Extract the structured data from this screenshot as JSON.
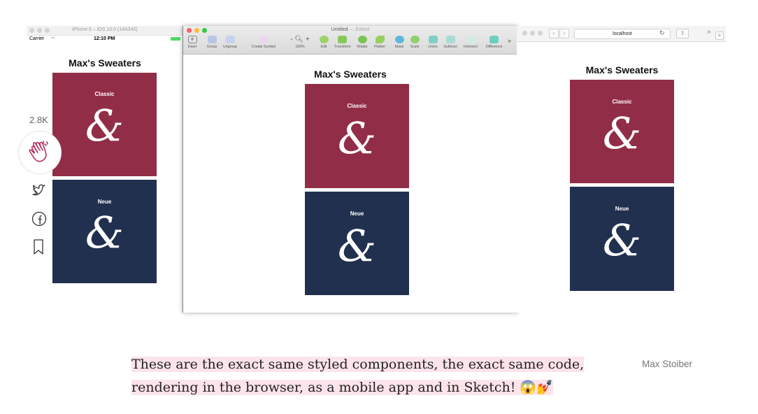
{
  "simulator": {
    "window_title": "iPhone 6 – iOS 10.0 (14A345)",
    "carrier": "Carrier",
    "time": "12:10 PM"
  },
  "sketch": {
    "document_title": "Untitled",
    "edited_label": "— Edited",
    "toolbar": {
      "insert": "Insert",
      "group": "Group",
      "ungroup": "Ungroup",
      "create_symbol": "Create Symbol",
      "zoom": "100%",
      "edit": "Edit",
      "transform": "Transform",
      "rotate": "Rotate",
      "flatten": "Flatten",
      "mask": "Mask",
      "scale": "Scale",
      "union": "Union",
      "subtract": "Subtract",
      "intersect": "Intersect",
      "difference": "Difference"
    }
  },
  "browser": {
    "url": "localhost"
  },
  "app": {
    "title": "Max's Sweaters",
    "cards": [
      {
        "label": "Classic",
        "glyph": "&",
        "color": "#922d48"
      },
      {
        "label": "Neue",
        "glyph": "&",
        "color": "#22304f"
      }
    ]
  },
  "share": {
    "clap_count": "2.8K",
    "icons": [
      "clap-icon",
      "twitter-icon",
      "facebook-icon",
      "bookmark-icon"
    ]
  },
  "caption": {
    "text": "These are the exact same styled components, the exact same code, rendering in the browser, as a mobile app and in Sketch! 😱💅",
    "credit": "Max Stoiber",
    "highlight_color": "#fde3ea"
  }
}
